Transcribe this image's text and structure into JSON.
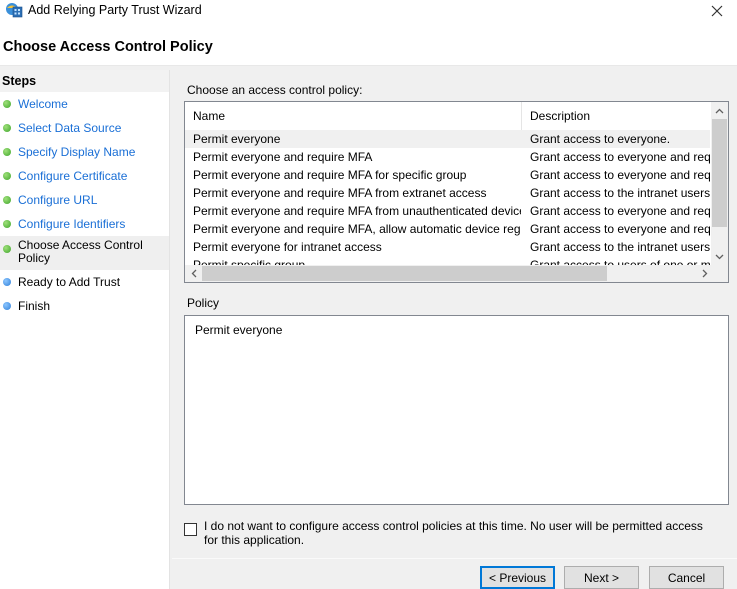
{
  "window": {
    "title": "Add Relying Party Trust Wizard",
    "icon": "wizard-app-icon",
    "close_icon": "close-icon"
  },
  "page": {
    "title": "Choose Access Control Policy"
  },
  "steps": {
    "header": "Steps",
    "items": [
      {
        "label": "Welcome",
        "state": "completed",
        "link": true
      },
      {
        "label": "Select Data Source",
        "state": "completed",
        "link": true
      },
      {
        "label": "Specify Display Name",
        "state": "completed",
        "link": true
      },
      {
        "label": "Configure Certificate",
        "state": "completed",
        "link": true
      },
      {
        "label": "Configure URL",
        "state": "completed",
        "link": true
      },
      {
        "label": "Configure Identifiers",
        "state": "completed",
        "link": true
      },
      {
        "label": "Choose Access Control Policy",
        "state": "current",
        "link": false
      },
      {
        "label": "Ready to Add Trust",
        "state": "pending",
        "link": false
      },
      {
        "label": "Finish",
        "state": "pending",
        "link": false
      }
    ]
  },
  "policy_list": {
    "prompt": "Choose an access control policy:",
    "columns": [
      "Name",
      "Description"
    ],
    "rows": [
      {
        "name": "Permit everyone",
        "description": "Grant access to everyone.",
        "selected": true
      },
      {
        "name": "Permit everyone and require MFA",
        "description": "Grant access to everyone and requir"
      },
      {
        "name": "Permit everyone and require MFA for specific group",
        "description": "Grant access to everyone and requir"
      },
      {
        "name": "Permit everyone and require MFA from extranet access",
        "description": "Grant access to the intranet users an"
      },
      {
        "name": "Permit everyone and require MFA from unauthenticated devices",
        "description": "Grant access to everyone and requir"
      },
      {
        "name": "Permit everyone and require MFA, allow automatic device registr...",
        "description": "Grant access to everyone and requir"
      },
      {
        "name": "Permit everyone for intranet access",
        "description": "Grant access to the intranet users."
      },
      {
        "name": "Permit specific group",
        "description": "Grant access to users of one or more"
      }
    ],
    "scroll_up": "^",
    "scroll_down": "v",
    "scroll_left": "<",
    "scroll_right": ">"
  },
  "policy_detail": {
    "label": "Policy",
    "value": "Permit everyone"
  },
  "opt_out": {
    "checked": false,
    "label": "I do not want to configure access control policies at this time. No user will be permitted access for this application."
  },
  "buttons": {
    "previous": "< Previous",
    "next": "Next >",
    "cancel": "Cancel"
  },
  "colors": {
    "link": "#1a6fd6",
    "completed_dot": "#3ea52a",
    "pending_dot": "#2f7fd8",
    "default_button_border": "#0078d7"
  }
}
